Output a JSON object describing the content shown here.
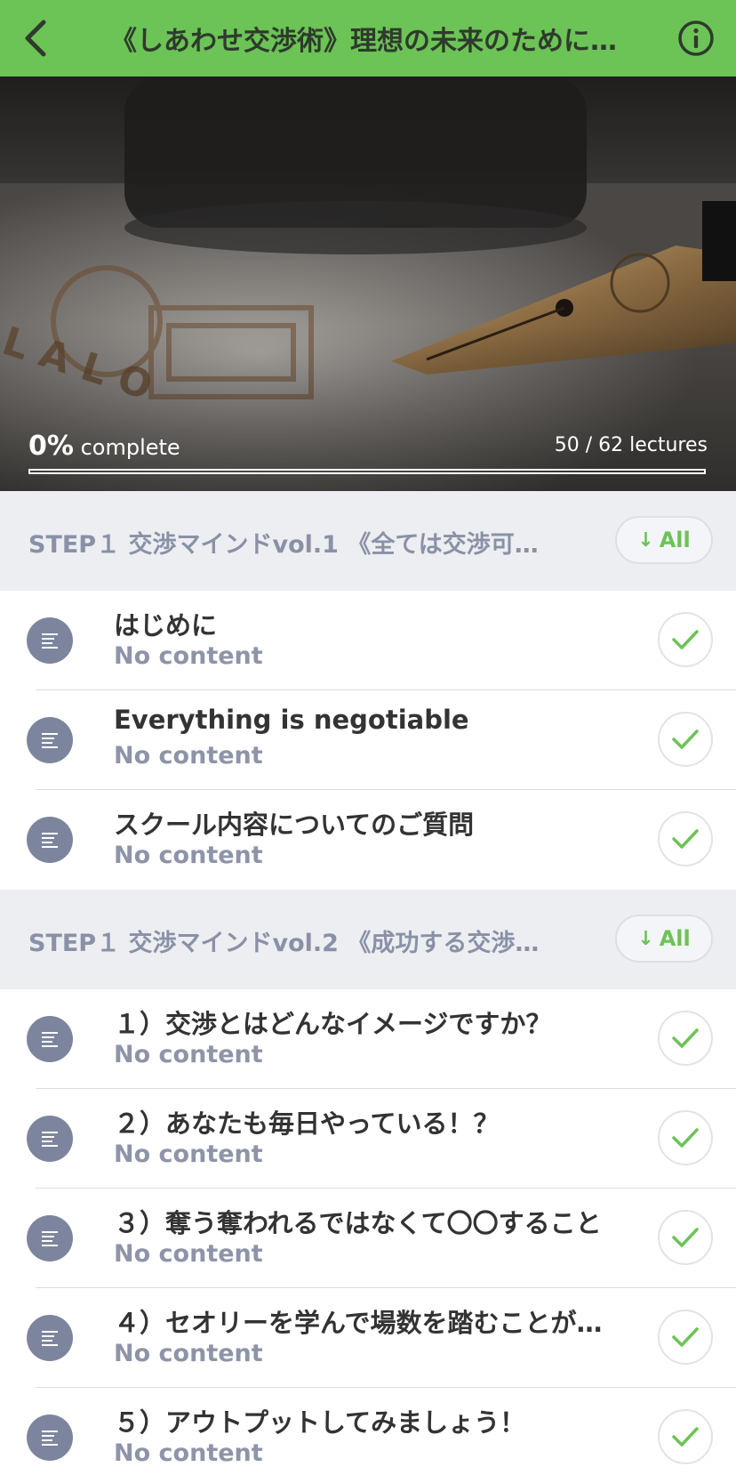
{
  "header": {
    "title": "《しあわせ交渉術》理想の未来のために…"
  },
  "hero": {
    "progress_value": "0%",
    "progress_label": "complete",
    "lectures_count": "50 / 62 lectures",
    "progress_fraction": 0.0
  },
  "sections": [
    {
      "title": "STEP１ 交渉マインドvol.1 《全ては交渉可…",
      "all_label": "All",
      "lectures": [
        {
          "title": "はじめに",
          "subtitle": "No content"
        },
        {
          "title": "Everything is negotiable",
          "subtitle": "No content"
        },
        {
          "title": "スクール内容についてのご質問",
          "subtitle": "No content"
        }
      ]
    },
    {
      "title": "STEP１ 交渉マインドvol.2 《成功する交渉…",
      "all_label": "All",
      "lectures": [
        {
          "title": "１）交渉とはどんなイメージですか？",
          "subtitle": "No content"
        },
        {
          "title": "２）あなたも毎日やっている！？",
          "subtitle": "No content"
        },
        {
          "title": "３）奪う奪われるではなくて〇〇すること",
          "subtitle": "No content"
        },
        {
          "title": "４）セオリーを学んで場数を踏むことが…",
          "subtitle": "No content"
        },
        {
          "title": "５）アウトプットしてみましょう！",
          "subtitle": "No content"
        }
      ]
    }
  ],
  "colors": {
    "accent": "#6cc356",
    "section_bg": "#eceef2",
    "icon_bg": "#7d859e"
  }
}
